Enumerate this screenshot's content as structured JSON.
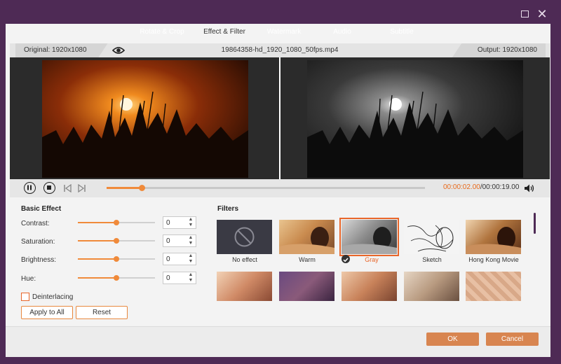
{
  "window": {
    "maximize_icon": "maximize-icon",
    "close_label": "✕"
  },
  "tabs": [
    {
      "label": "Rotate & Crop",
      "active": false
    },
    {
      "label": "Effect & Filter",
      "active": true
    },
    {
      "label": "Watermark",
      "active": false
    },
    {
      "label": "Audio",
      "active": false
    },
    {
      "label": "Subtitle",
      "active": false
    }
  ],
  "info_bar": {
    "original": "Original: 1920x1080",
    "file_name": "19864358-hd_1920_1080_50fps.mp4",
    "output": "Output: 1920x1080"
  },
  "playback": {
    "current_time": "00:00:02.00",
    "total_time": "/00:00:19.00",
    "progress_fraction": 0.11
  },
  "basic_effect": {
    "title": "Basic Effect",
    "rows": [
      {
        "label": "Contrast:",
        "value": "0",
        "slider_fraction": 0.5
      },
      {
        "label": "Saturation:",
        "value": "0",
        "slider_fraction": 0.5
      },
      {
        "label": "Brightness:",
        "value": "0",
        "slider_fraction": 0.5
      },
      {
        "label": "Hue:",
        "value": "0",
        "slider_fraction": 0.5
      }
    ],
    "deinterlacing": {
      "label": "Deinterlacing",
      "checked": false
    },
    "apply_all": "Apply to All",
    "reset": "Reset"
  },
  "filters": {
    "title": "Filters",
    "items": [
      {
        "label": "No effect",
        "selected": false
      },
      {
        "label": "Warm",
        "selected": false
      },
      {
        "label": "Gray",
        "selected": true
      },
      {
        "label": "Sketch",
        "selected": false
      },
      {
        "label": "Hong Kong Movie",
        "selected": false
      }
    ]
  },
  "footer": {
    "ok": "OK",
    "cancel": "Cancel"
  },
  "colors": {
    "accent": "#f08a3a",
    "frame": "#4e2a55",
    "button": "#d88550"
  }
}
